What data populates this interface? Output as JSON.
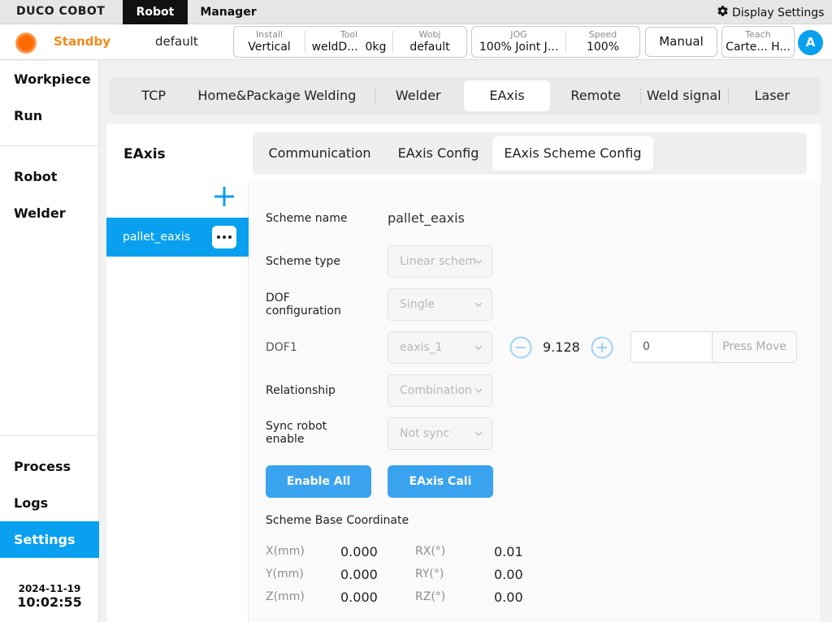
{
  "topnav": {
    "logo": "DUCO COBOT",
    "tabs": [
      "Robot",
      "Manager"
    ],
    "display_settings": "Display Settings"
  },
  "status": {
    "state": "Standby",
    "program": "default",
    "install": {
      "label": "Install",
      "value": "Vertical"
    },
    "tool": {
      "label": "Tool",
      "value": "weldD...",
      "load": "0kg"
    },
    "wobj": {
      "label": "Wobj",
      "value": "default"
    },
    "jog": {
      "label": "JOG",
      "value": "100% Joint J..."
    },
    "speed": {
      "label": "Speed",
      "value": "100%"
    },
    "mode": "Manual",
    "teach": {
      "label": "Teach",
      "value": "Carte...  H..."
    },
    "avatar": "A"
  },
  "sidebar": {
    "items": [
      "Workpiece",
      "Run",
      "Robot",
      "Welder",
      "Process",
      "Logs",
      "Settings"
    ],
    "active": "Settings",
    "date": "2024-11-19",
    "time": "10:02:55"
  },
  "main_tabs": [
    "TCP",
    "Home&Package",
    "Welding",
    "Welder",
    "EAxis",
    "Remote",
    "Weld signal",
    "Laser"
  ],
  "main_tab_active": "EAxis",
  "section_title": "EAxis",
  "sub_tabs": [
    "Communication",
    "EAxis Config",
    "EAxis Scheme Config"
  ],
  "sub_tab_active": "EAxis Scheme Config",
  "schemes": [
    {
      "name": "pallet_eaxis"
    }
  ],
  "form": {
    "scheme_name_label": "Scheme name",
    "scheme_name_value": "pallet_eaxis",
    "scheme_type_label": "Scheme type",
    "scheme_type_value": "Linear schem",
    "dof_config_label": "DOF configuration",
    "dof_config_value": "Single",
    "dof1_label": "DOF1",
    "dof1_value": "eaxis_1",
    "dof1_position": "9.128",
    "move_input_value": "0",
    "press_move_label": "Press Move",
    "relationship_label": "Relationship",
    "relationship_value": "Combination",
    "sync_label": "Sync robot enable",
    "sync_value": "Not sync",
    "enable_all_label": "Enable All",
    "eaxis_cali_label": "EAxis Cali"
  },
  "base_coordinate": {
    "title": "Scheme Base Coordinate",
    "x": {
      "label": "X(mm)",
      "value": "0.000"
    },
    "y": {
      "label": "Y(mm)",
      "value": "0.000"
    },
    "z": {
      "label": "Z(mm)",
      "value": "0.000"
    },
    "rx": {
      "label": "RX(°)",
      "value": "0.01"
    },
    "ry": {
      "label": "RY(°)",
      "value": "0.00"
    },
    "rz": {
      "label": "RZ(°)",
      "value": "0.00"
    }
  },
  "colors": {
    "accent": "#0aa0f0",
    "button": "#3aa3f0",
    "standby": "#f08c1a"
  }
}
